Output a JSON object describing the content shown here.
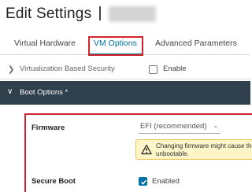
{
  "header": {
    "title": "Edit Settings"
  },
  "tabs": [
    {
      "label": "Virtual Hardware"
    },
    {
      "label": "VM Options"
    },
    {
      "label": "Advanced Parameters"
    }
  ],
  "vbs_row": {
    "label": "Virtualization Based Security",
    "checkbox_label": "Enable",
    "checked": false
  },
  "boot_options": {
    "section_label": "Boot Options *",
    "firmware": {
      "label": "Firmware",
      "value": "EFI (recommended)",
      "warning": "Changing firmware might cause the\nunbootable."
    },
    "secure_boot": {
      "label": "Secure Boot",
      "checkbox_label": "Enabled",
      "checked": true
    }
  },
  "colors": {
    "accent": "#0072a3",
    "highlight": "#d2262c",
    "section_header": "#2f3f4c",
    "warning_bg": "#fdf4c7"
  }
}
